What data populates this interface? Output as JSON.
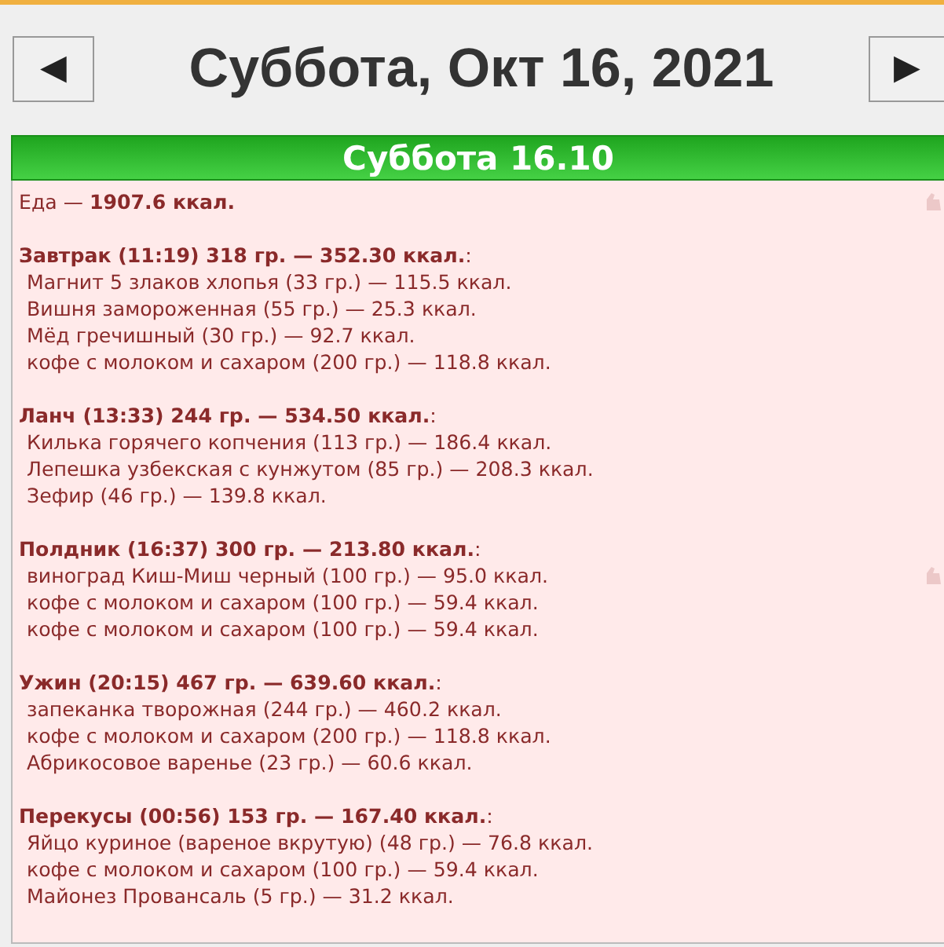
{
  "header": {
    "prev": "◀",
    "title": "Суббота, Окт 16, 2021",
    "next": "▶"
  },
  "day_bar": "Суббота 16.10",
  "total": {
    "text": "Еда — **1907.6 ккал.**",
    "thumb": true
  },
  "meals": [
    {
      "heading": "**Завтрак (11:19) 318 гр. — 352.30 ккал.**:",
      "items": [
        {
          "text": "Магнит 5 злаков хлопья (33 гр.) — 115.5 ккал."
        },
        {
          "text": "Вишня замороженная (55 гр.) — 25.3 ккал."
        },
        {
          "text": "Мёд гречишный (30 гр.) — 92.7 ккал."
        },
        {
          "text": "кофе с молоком и сахаром (200 гр.) — 118.8 ккал."
        }
      ]
    },
    {
      "heading": "**Ланч (13:33) 244 гр. — 534.50 ккал.**:",
      "items": [
        {
          "text": "Килька горячего копчения (113 гр.) — 186.4 ккал."
        },
        {
          "text": "Лепешка узбекская с кунжутом (85 гр.) — 208.3 ккал."
        },
        {
          "text": "Зефир (46 гр.) — 139.8 ккал."
        }
      ]
    },
    {
      "heading": "**Полдник (16:37) 300 гр. — 213.80 ккал.**:",
      "items": [
        {
          "text": "виноград Киш-Миш черный (100 гр.) — 95.0 ккал.",
          "thumb": true
        },
        {
          "text": "кофе с молоком и сахаром (100 гр.) — 59.4 ккал."
        },
        {
          "text": "кофе с молоком и сахаром (100 гр.) — 59.4 ккал."
        }
      ]
    },
    {
      "heading": "**Ужин (20:15) 467 гр. — 639.60 ккал.**:",
      "items": [
        {
          "text": "запеканка творожная (244 гр.) — 460.2 ккал."
        },
        {
          "text": "кофе с молоком и сахаром (200 гр.) — 118.8 ккал."
        },
        {
          "text": "Абрикосовое варенье (23 гр.) — 60.6 ккал."
        }
      ]
    },
    {
      "heading": "**Перекусы (00:56) 153 гр. — 167.40 ккал.**:",
      "items": [
        {
          "text": "Яйцо куриное (вареное вкрутую) (48 гр.) — 76.8 ккал."
        },
        {
          "text": "кофе с молоком и сахаром (100 гр.) — 59.4 ккал."
        },
        {
          "text": "Майонез Провансаль (5 гр.) — 31.2 ккал."
        }
      ]
    }
  ]
}
